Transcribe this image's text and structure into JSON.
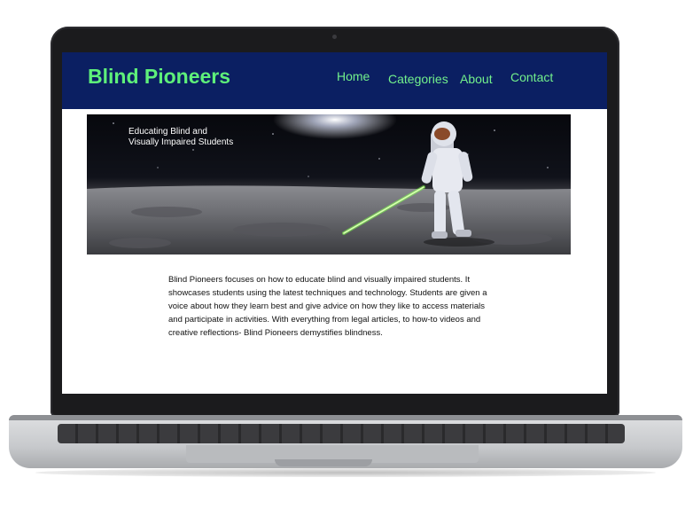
{
  "site": {
    "brand": "Blind Pioneers",
    "nav": [
      "Home",
      "Categories",
      "About",
      "Contact"
    ]
  },
  "hero": {
    "caption_line1": "Educating Blind and",
    "caption_line2": "Visually Impaired Students"
  },
  "intro": {
    "text": "Blind Pioneers focuses on how to educate blind and visually impaired students. It showcases students using the latest techniques and technology. Students are given a voice about how they learn best and give advice on how they like to access materials and participate in activities. With everything from legal articles, to how-to videos and creative reflections- Blind Pioneers demystifies blindness."
  },
  "colors": {
    "header_bg": "#0b1f62",
    "brand_green": "#5ef07a",
    "nav_green": "#72f08c",
    "cane_glow": "#7cff4a"
  }
}
